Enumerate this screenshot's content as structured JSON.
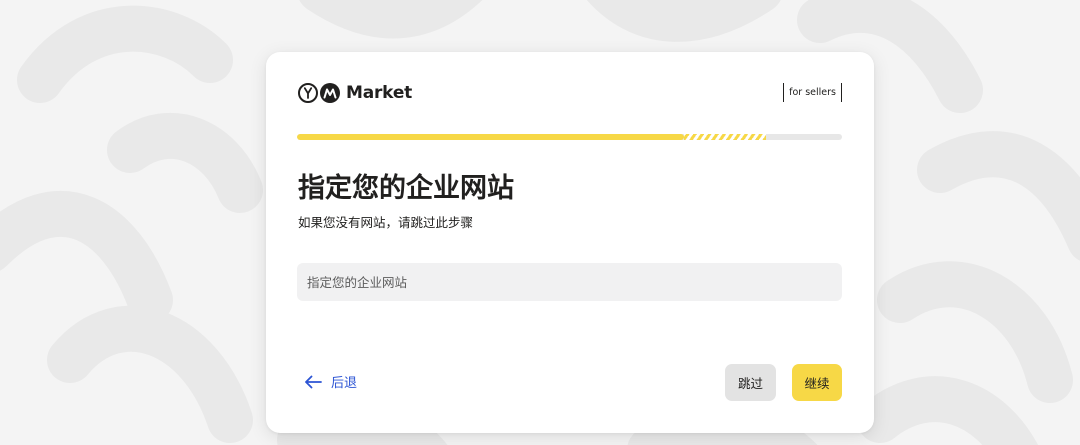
{
  "colors": {
    "accent": "#f7d846",
    "link": "#2c54d4",
    "text": "#21201f"
  },
  "header": {
    "logo_icon": "yandex-market-logo",
    "logo_text": "Market",
    "sellers_label": "for sellers"
  },
  "progress": {
    "fraction": 0.86
  },
  "main": {
    "title": "指定您的企业网站",
    "subtitle": "如果您没有网站，请跳过此步骤",
    "website_input": {
      "placeholder": "指定您的企业网站",
      "value": ""
    }
  },
  "footer": {
    "back_icon": "arrow-left-icon",
    "back_label": "后退",
    "skip_label": "跳过",
    "continue_label": "继续"
  }
}
